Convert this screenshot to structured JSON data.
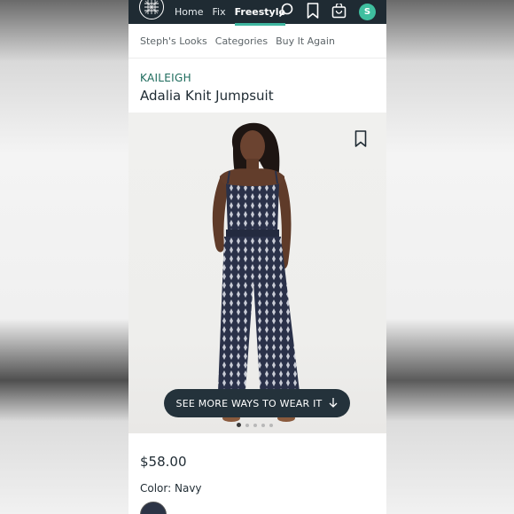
{
  "nav": {
    "links": [
      "Home",
      "Fix",
      "Freestyle"
    ],
    "avatar_letter": "S"
  },
  "subnav": [
    "Steph's Looks",
    "Categories",
    "Buy It Again"
  ],
  "product": {
    "brand": "KAILEIGH",
    "title": "Adalia Knit Jumpsuit",
    "price": "$58.00",
    "color_label": "Color:",
    "color_value": "Navy"
  },
  "hero": {
    "cta_label": "SEE MORE WAYS TO WEAR IT",
    "carousel_dots": 5,
    "active_dot": 0
  },
  "colors": {
    "nav_bg": "#1f2b33",
    "accent": "#3fb6a0",
    "brand_text": "#1d6b5c",
    "avatar": "#3fbf9f"
  }
}
